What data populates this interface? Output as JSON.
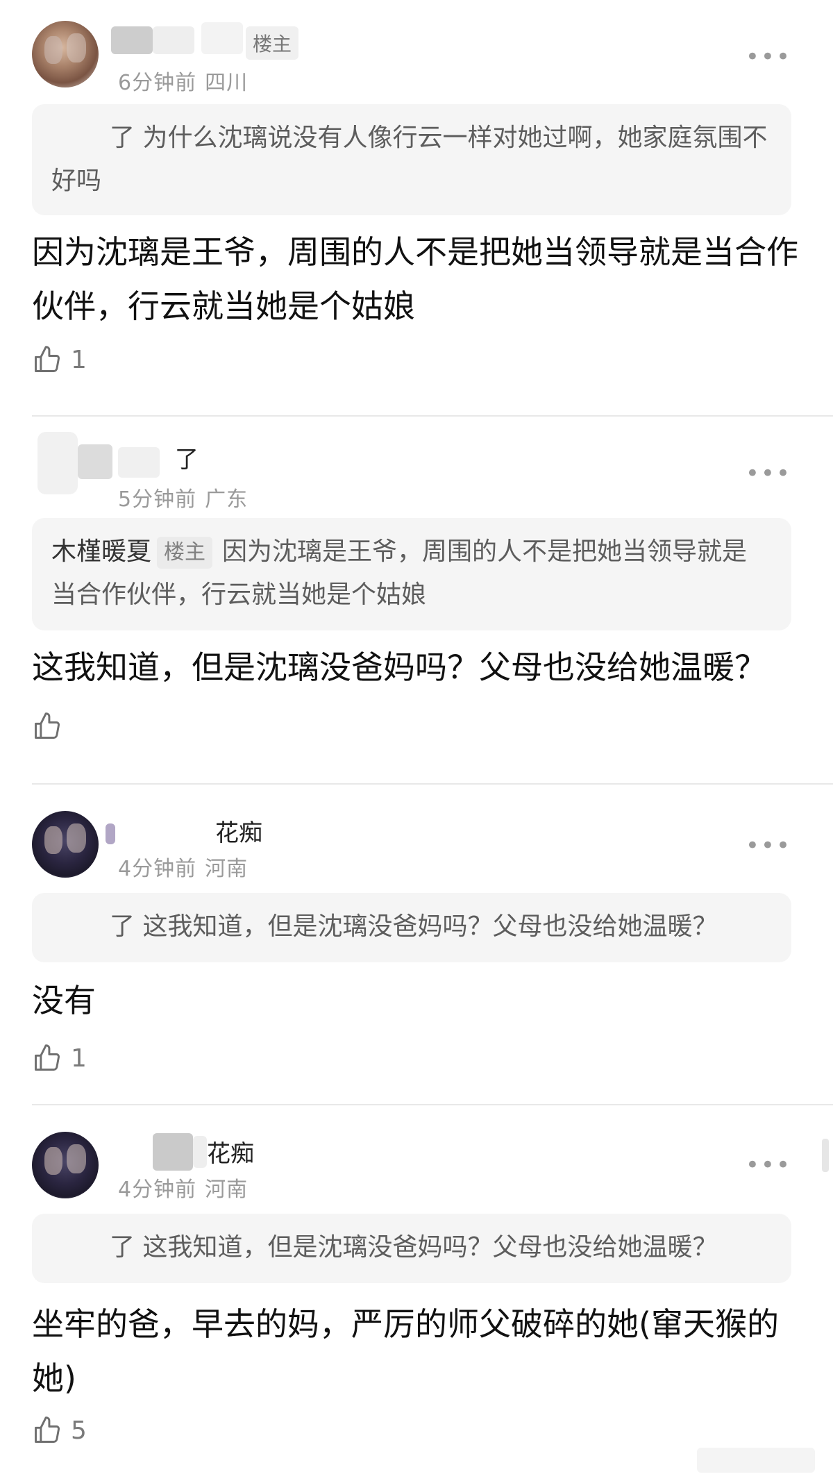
{
  "comments": [
    {
      "name_suffix": "楼主",
      "time": "6分钟前",
      "location": "四川",
      "quote_text": "了 为什么沈璃说没有人像行云一样对她过啊，她家庭氛围不好吗",
      "body": "因为沈璃是王爷，周围的人不是把她当领导就是当合作伙伴，行云就当她是个姑娘",
      "likes": "1"
    },
    {
      "name_suffix": "了",
      "time": "5分钟前",
      "location": "广东",
      "quote_name": "木槿暖夏",
      "quote_badge": "楼主",
      "quote_text": "因为沈璃是王爷，周围的人不是把她当领导就是当合作伙伴，行云就当她是个姑娘",
      "body": "这我知道，但是沈璃没爸妈吗？父母也没给她温暖？",
      "likes": ""
    },
    {
      "name_suffix": "花痴",
      "time": "4分钟前",
      "location": "河南",
      "quote_text": "了 这我知道，但是沈璃没爸妈吗？父母也没给她温暖？",
      "body": "没有",
      "likes": "1"
    },
    {
      "name_suffix": "花痴",
      "time": "4分钟前",
      "location": "河南",
      "quote_text": "了 这我知道，但是沈璃没爸妈吗？父母也没给她温暖？",
      "body": "坐牢的爸，早去的妈，严厉的师父破碎的她(窜天猴的她)",
      "likes": "5"
    }
  ],
  "more_glyph": "•••",
  "icons": {
    "like": "thumbs-up-icon",
    "more": "more-dots-icon"
  },
  "colors": {
    "quote_bg": "#f5f5f5",
    "meta": "#9a9a9a",
    "divider": "#e8e8e8"
  }
}
